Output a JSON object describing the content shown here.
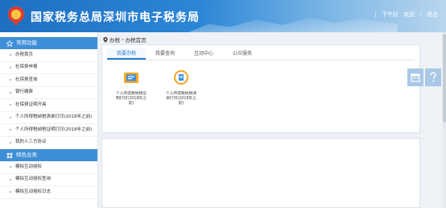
{
  "header": {
    "site_title": "国家税务总局深圳市电子税务局",
    "user_text": "下午好",
    "welcome": "欢迎",
    "logout": "退出",
    "sep": "|"
  },
  "sidebar": {
    "section1": "常用功能",
    "items1": [
      "办税首页",
      "社保费申报",
      "社保费查询",
      "银行缴费",
      "社保费证明开具",
      "个人所得税纳税清单打印(2018年之前)",
      "个人所得税纳税证明打印(2018年之前)",
      "我的人三方协议"
    ],
    "section2": "特色业务",
    "items2": [
      "模拟互动授权",
      "模拟互动授权查询",
      "模拟互动授权日志"
    ]
  },
  "breadcrumb": {
    "root": "办税",
    "arrow": "›",
    "current": "办税首页"
  },
  "tabs": [
    "我要办税",
    "我要查询",
    "互动中心",
    "公众服务"
  ],
  "tiles": [
    {
      "label": "个人所得税纳税证明打印(2018年之前)"
    },
    {
      "label": "个人所得税纳税清单打印(2018年之前)"
    }
  ],
  "colors": {
    "accent": "#2c7cd1",
    "section": "#3f8fd8"
  },
  "icons": {
    "calendar": "calendar-icon",
    "help": "help-icon"
  }
}
